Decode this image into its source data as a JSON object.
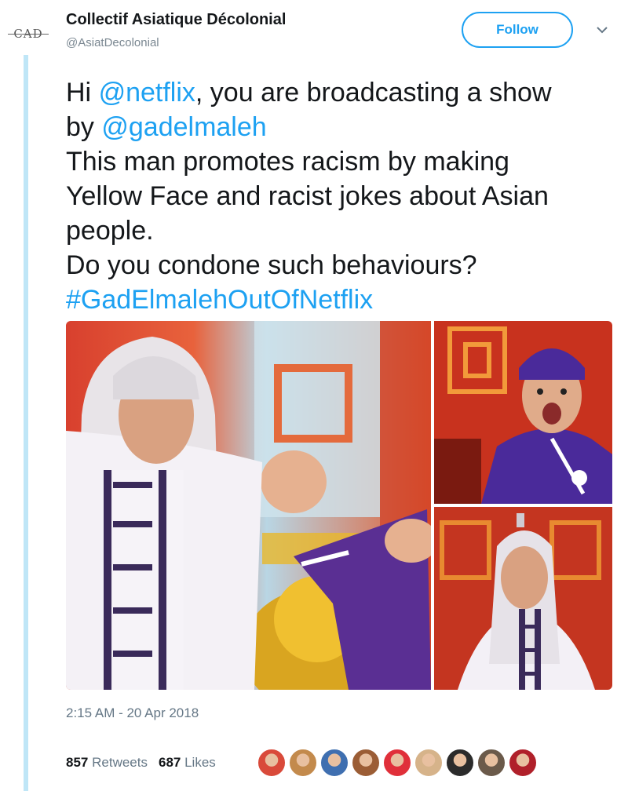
{
  "header": {
    "avatar_text": "CAD",
    "name": "Collectif Asiatique Décolonial",
    "handle": "@AsiatDecolonial",
    "follow_label": "Follow",
    "chevron": "⌄"
  },
  "tweet": {
    "line1_prefix": "Hi ",
    "line1_mention": "@netflix",
    "line1_suffix": ", you are broadcasting a show",
    "line2_prefix": "by ",
    "line2_mention": "@gadelmaleh",
    "line3": "This man promotes racism by making",
    "line4": "Yellow Face and racist jokes about Asian",
    "line5": "people.",
    "line6": "Do you condone such behaviours?",
    "hashtag": "#GadElmalehOutOfNetflix"
  },
  "media": {
    "photos": [
      {
        "name": "photo-main",
        "label": "performer in white wig and white robe with purple frog buttons, red stage background"
      },
      {
        "name": "photo-top-right",
        "label": "performer in purple cap and purple robe with open mouth"
      },
      {
        "name": "photo-bottom-right",
        "label": "performer in white wig and white robe"
      }
    ]
  },
  "timestamp": "2:15 AM - 20 Apr 2018",
  "stats": {
    "retweets_count": "857",
    "retweets_label": "Retweets",
    "likes_count": "687",
    "likes_label": "Likes"
  },
  "likers": {
    "count": 9,
    "colors": [
      "#d94a3a",
      "#c38a4c",
      "#3f6fb0",
      "#9b5d35",
      "#e0303a",
      "#d6b38a",
      "#2b2b2b",
      "#6b5a4a",
      "#b0202a"
    ]
  },
  "colors": {
    "accent": "#1da1f2",
    "muted": "#657786",
    "thread_line": "#bfe6f7"
  }
}
